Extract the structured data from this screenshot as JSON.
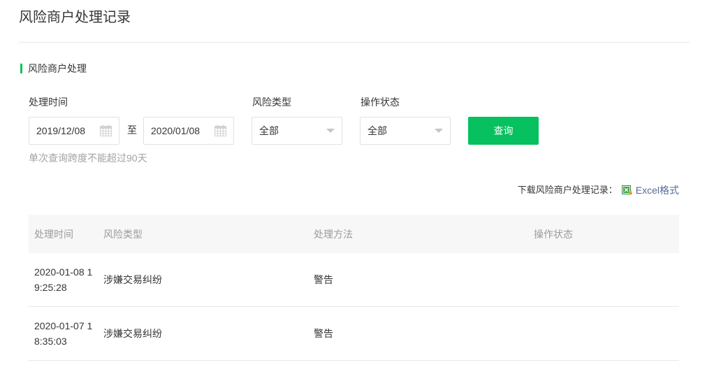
{
  "page": {
    "title": "风险商户处理记录"
  },
  "section": {
    "title": "风险商户处理"
  },
  "filters": {
    "date": {
      "label": "处理时间",
      "start_value": "2019/12/08",
      "separator": "至",
      "end_value": "2020/01/08",
      "icon": "calendar-icon"
    },
    "risk_type": {
      "label": "风险类型",
      "selected": "全部",
      "icon": "chevron-down-icon"
    },
    "status": {
      "label": "操作状态",
      "selected": "全部",
      "icon": "chevron-down-icon"
    },
    "query_button": {
      "label": "查询"
    },
    "hint": "单次查询跨度不能超过90天"
  },
  "download": {
    "label": "下载风险商户处理记录：",
    "icon": "excel-icon",
    "link_text": "Excel格式"
  },
  "table": {
    "columns": [
      "处理时间",
      "风险类型",
      "处理方法",
      "操作状态"
    ],
    "rows": [
      {
        "time": "2020-01-08 19:25:28",
        "risk_type": "涉嫌交易纠纷",
        "method": "警告"
      },
      {
        "time": "2020-01-07 18:35:03",
        "risk_type": "涉嫌交易纠纷",
        "method": "警告"
      }
    ]
  },
  "colors": {
    "accent": "#07c160",
    "link": "#576b95"
  }
}
